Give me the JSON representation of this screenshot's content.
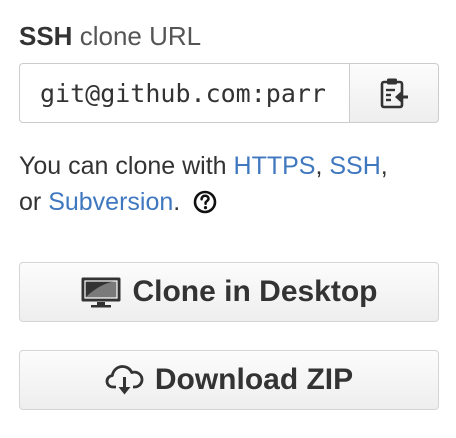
{
  "clone": {
    "protocol": "SSH",
    "heading_rest": "clone URL",
    "url_value": "git@github.com:parr"
  },
  "help": {
    "prefix": "You can clone with ",
    "https_link": "HTTPS",
    "comma1": ", ",
    "ssh_link": "SSH",
    "comma2": ",",
    "or_text": "or ",
    "subversion_link": "Subversion",
    "period": "."
  },
  "buttons": {
    "desktop_label": "Clone in Desktop",
    "zip_label": "Download ZIP"
  },
  "icons": {
    "copy": "clipboard-icon",
    "help": "question-circle-icon",
    "desktop": "monitor-icon",
    "download": "cloud-download-icon"
  },
  "colors": {
    "link": "#4078c0",
    "text": "#333333",
    "border": "#cccccc"
  }
}
